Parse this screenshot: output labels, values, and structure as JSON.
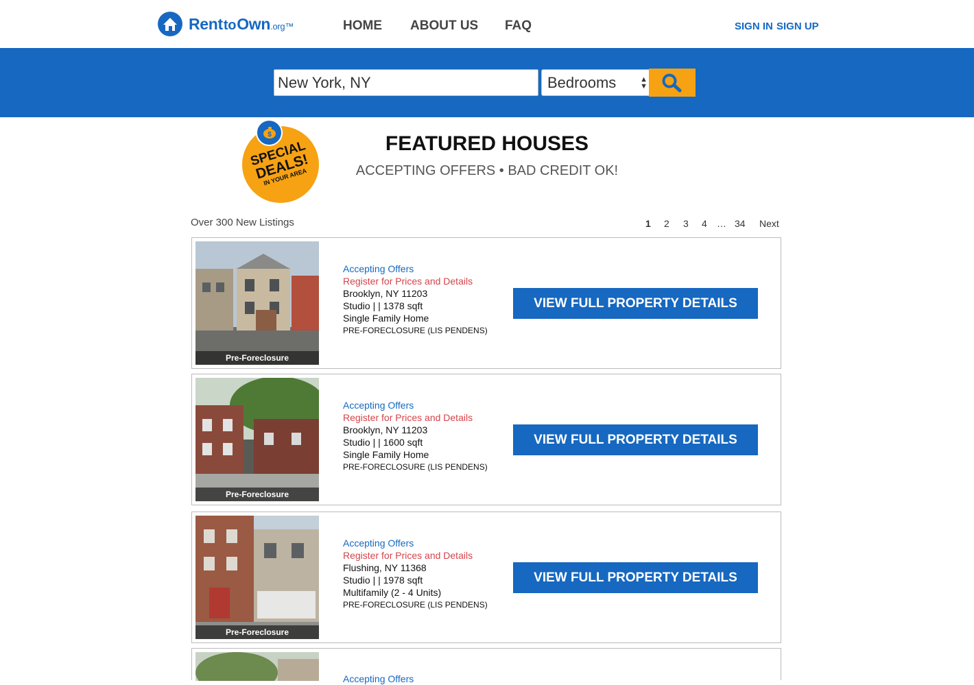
{
  "brand": {
    "name_rent": "Rent",
    "name_to": "to",
    "name_own": "Own",
    "name_tld": ".org™",
    "primary_color": "#1668c0",
    "accent_color": "#f7a212"
  },
  "nav": {
    "home": "HOME",
    "about": "ABOUT US",
    "faq": "FAQ",
    "sign_in": "SIGN IN",
    "sign_up": "SIGN UP"
  },
  "search": {
    "location_value": "New York, NY",
    "bedrooms_value": "Bedrooms"
  },
  "featured": {
    "badge_line1": "SPECIAL",
    "badge_line2": "DEALS!",
    "badge_line3": "IN YOUR AREA",
    "title": "FEATURED HOUSES",
    "subtitle": "ACCEPTING OFFERS • BAD CREDIT OK!"
  },
  "listings_meta": {
    "count_text": "Over 300 New Listings",
    "pages": [
      "1",
      "2",
      "3",
      "4",
      "…",
      "34"
    ],
    "next": "Next"
  },
  "listings": [
    {
      "photo_label": "Pre-Foreclosure",
      "status": "Accepting Offers",
      "register": "Register for Prices and Details",
      "location": "Brooklyn, NY 11203",
      "size": "Studio | | 1378 sqft",
      "type": "Single Family Home",
      "category": "PRE-FORECLOSURE (LIS PENDENS)",
      "button": "VIEW FULL PROPERTY DETAILS"
    },
    {
      "photo_label": "Pre-Foreclosure",
      "status": "Accepting Offers",
      "register": "Register for Prices and Details",
      "location": "Brooklyn, NY 11203",
      "size": "Studio | | 1600 sqft",
      "type": "Single Family Home",
      "category": "PRE-FORECLOSURE (LIS PENDENS)",
      "button": "VIEW FULL PROPERTY DETAILS"
    },
    {
      "photo_label": "Pre-Foreclosure",
      "status": "Accepting Offers",
      "register": "Register for Prices and Details",
      "location": "Flushing, NY 11368",
      "size": "Studio | | 1978 sqft",
      "type": "Multifamily (2 - 4 Units)",
      "category": "PRE-FORECLOSURE (LIS PENDENS)",
      "button": "VIEW FULL PROPERTY DETAILS"
    },
    {
      "status": "Accepting Offers"
    }
  ]
}
